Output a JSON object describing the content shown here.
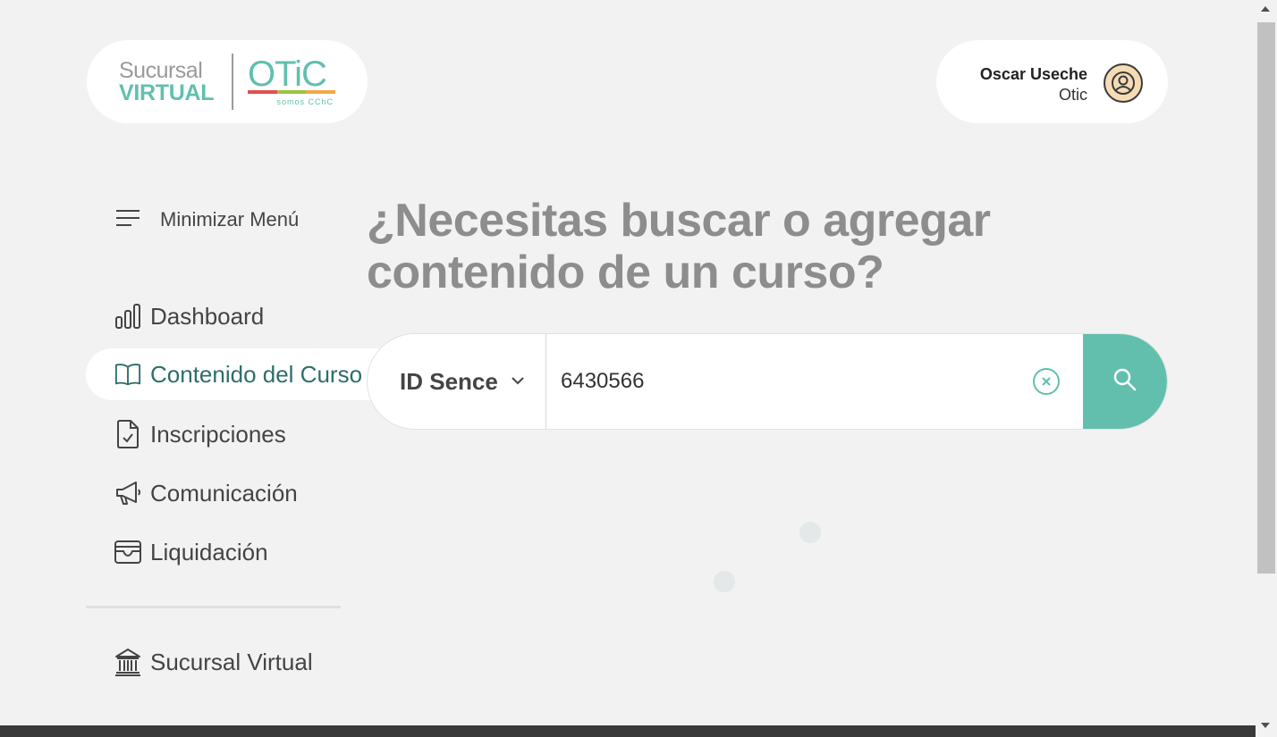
{
  "header": {
    "logo": {
      "line1": "Sucursal",
      "line2": "VIRTUAL",
      "brand": "OTiC",
      "tagline": "somos CChC",
      "bar_colors": [
        "#e0514e",
        "#9bc53d",
        "#f0a942"
      ]
    },
    "user": {
      "name": "Oscar Useche",
      "organization": "Otic",
      "avatar_icon": "user-circle-icon"
    }
  },
  "sidebar": {
    "minimize_label": "Minimizar Menú",
    "items": [
      {
        "label": "Dashboard",
        "icon": "bar-chart-icon",
        "active": false
      },
      {
        "label": "Contenido del Curso",
        "icon": "open-book-icon",
        "active": true
      },
      {
        "label": "Inscripciones",
        "icon": "document-check-icon",
        "active": false
      },
      {
        "label": "Comunicación",
        "icon": "megaphone-icon",
        "active": false
      },
      {
        "label": "Liquidación",
        "icon": "archive-box-icon",
        "active": false
      }
    ],
    "footer_item": {
      "label": "Sucursal Virtual",
      "icon": "bank-building-icon"
    }
  },
  "main": {
    "heading": "¿Necesitas buscar o agregar contenido de un curso?",
    "search": {
      "type_selected": "ID Sence",
      "value": "6430566",
      "clear_icon": "clear-circle-icon",
      "search_icon": "search-icon"
    }
  },
  "colors": {
    "accent": "#62bfae",
    "background": "#f2f2f2",
    "heading": "#8d8d8d",
    "active_nav_text": "#2e6e6a"
  }
}
